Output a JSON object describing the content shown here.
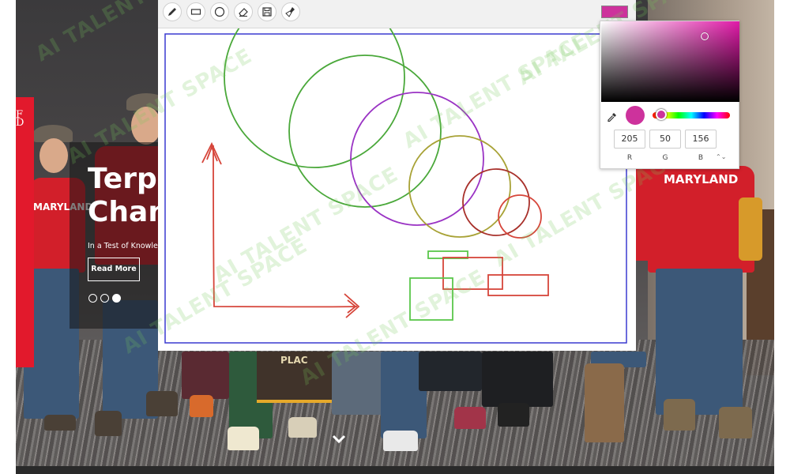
{
  "hero": {
    "title": "Terps\nChan",
    "subtitle": "In a Test of Knowled",
    "read_more": "Read More",
    "shirt_text_left": "MARYLAND",
    "shirt_text_right": "MARYLAND",
    "banner_text": "PLAC",
    "logo_text": "F\nD"
  },
  "toolbar": {
    "tools": [
      "pencil-icon",
      "rectangle-icon",
      "circle-icon",
      "eraser-icon",
      "save-icon",
      "clear-brush-icon"
    ],
    "current_color": "#cd329c"
  },
  "watermark": "AI TALENT SPACE",
  "color_picker": {
    "r": "205",
    "g": "50",
    "b": "156",
    "r_label": "R",
    "g_label": "G",
    "b_label": "B",
    "mode_toggle": "⌃⌄"
  },
  "colors": {
    "accent_red": "#e2192c",
    "canvas_border": "#3a3ad0",
    "stroke_green": "#4aa83a",
    "stroke_purple": "#9a33c4",
    "stroke_olive": "#a8a236",
    "stroke_darkred": "#a8302a",
    "stroke_red": "#d6453a",
    "stroke_lime": "#5ac74a"
  }
}
